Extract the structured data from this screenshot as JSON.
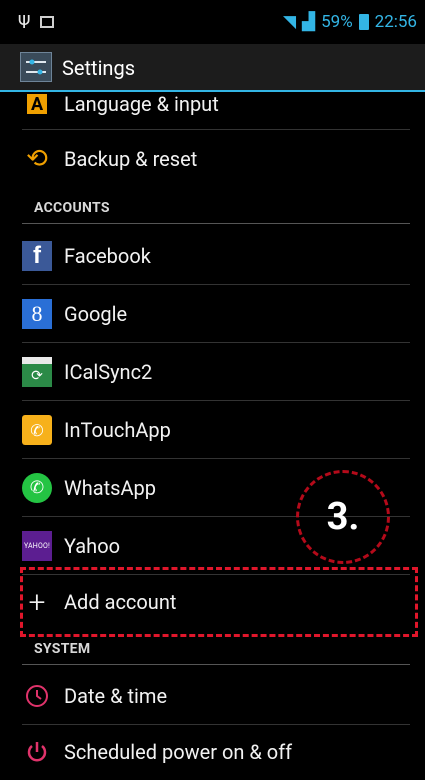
{
  "status_bar": {
    "left_icon": "usb-icon",
    "right_text": "59%",
    "time": "22:56",
    "accent": "#33b5e5"
  },
  "action_bar": {
    "title": "Settings"
  },
  "items_top": [
    {
      "label": "Language & input",
      "icon": "language-icon"
    },
    {
      "label": "Backup & reset",
      "icon": "backup-icon"
    }
  ],
  "sections": {
    "accounts": "ACCOUNTS",
    "system": "SYSTEM"
  },
  "accounts": [
    {
      "label": "Facebook",
      "icon": "facebook-icon",
      "glyph": "f"
    },
    {
      "label": "Google",
      "icon": "google-icon",
      "glyph": "8"
    },
    {
      "label": "ICalSync2",
      "icon": "calendar-icon",
      "glyph": "⟳"
    },
    {
      "label": "InTouchApp",
      "icon": "intouchapp-icon",
      "glyph": "✆"
    },
    {
      "label": "WhatsApp",
      "icon": "whatsapp-icon",
      "glyph": "✆"
    },
    {
      "label": "Yahoo",
      "icon": "yahoo-icon",
      "glyph": "YAHOO!"
    }
  ],
  "add_account": {
    "label": "Add account",
    "icon": "plus-icon"
  },
  "system": [
    {
      "label": "Date & time",
      "icon": "clock-icon"
    },
    {
      "label": "Scheduled power on & off",
      "icon": "power-icon"
    }
  ],
  "annotation": {
    "step_label": "3.",
    "color": "#e0162b"
  }
}
